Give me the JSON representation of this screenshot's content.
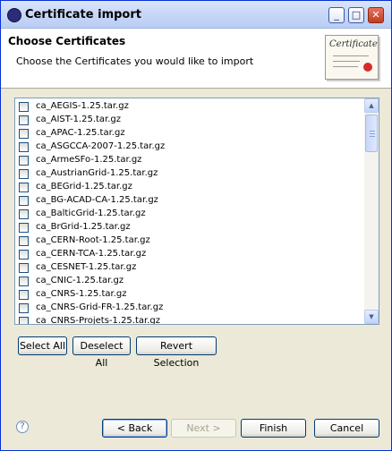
{
  "window": {
    "title": "Certificate import"
  },
  "titlebar_buttons": {
    "minimize": "_",
    "maximize": "□",
    "close": "✕"
  },
  "header": {
    "title": "Choose Certificates",
    "description": "Choose the Certificates you would like to import",
    "image_text": "Certificate"
  },
  "certificates": [
    "ca_AEGIS-1.25.tar.gz",
    "ca_AIST-1.25.tar.gz",
    "ca_APAC-1.25.tar.gz",
    "ca_ASGCCA-2007-1.25.tar.gz",
    "ca_ArmeSFo-1.25.tar.gz",
    "ca_AustrianGrid-1.25.tar.gz",
    "ca_BEGrid-1.25.tar.gz",
    "ca_BG-ACAD-CA-1.25.tar.gz",
    "ca_BalticGrid-1.25.tar.gz",
    "ca_BrGrid-1.25.tar.gz",
    "ca_CERN-Root-1.25.tar.gz",
    "ca_CERN-TCA-1.25.tar.gz",
    "ca_CESNET-1.25.tar.gz",
    "ca_CNIC-1.25.tar.gz",
    "ca_CNRS-1.25.tar.gz",
    "ca_CNRS-Grid-FR-1.25.tar.gz",
    "ca_CNRS-Projets-1.25.tar.gz"
  ],
  "selection_buttons": {
    "select_all": "Select All",
    "deselect_all": "Deselect All",
    "revert_selection": "Revert Selection"
  },
  "footer": {
    "help": "?",
    "back": "< Back",
    "next": "Next >",
    "finish": "Finish",
    "cancel": "Cancel"
  }
}
